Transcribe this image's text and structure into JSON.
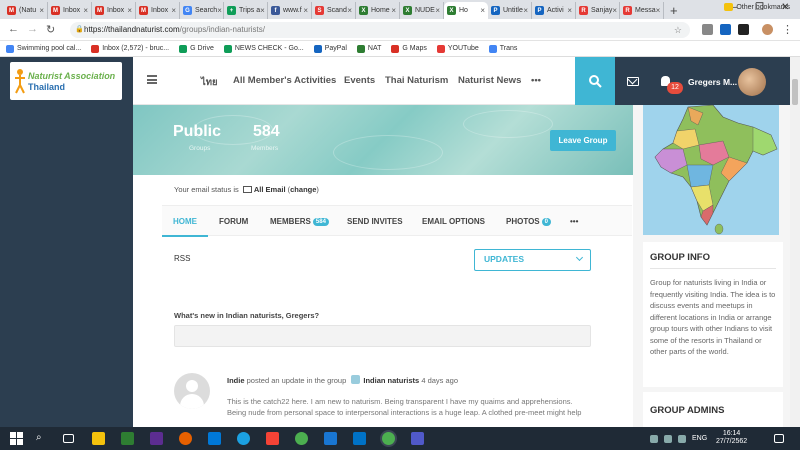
{
  "browser": {
    "tabs": [
      {
        "label": "(Natu",
        "color": "#d93025",
        "glyph": "M"
      },
      {
        "label": "Inbox",
        "color": "#d93025",
        "glyph": "M"
      },
      {
        "label": "Inbox",
        "color": "#d93025",
        "glyph": "M"
      },
      {
        "label": "Inbox",
        "color": "#d93025",
        "glyph": "M"
      },
      {
        "label": "Search",
        "color": "#4285f4",
        "glyph": "G"
      },
      {
        "label": "Trips a",
        "color": "#0f9d58",
        "glyph": "+"
      },
      {
        "label": "www.f",
        "color": "#3b5998",
        "glyph": "f"
      },
      {
        "label": "Scand",
        "color": "#e53935",
        "glyph": "S"
      },
      {
        "label": "Home",
        "color": "#2e7d32",
        "glyph": "X"
      },
      {
        "label": "NUDE",
        "color": "#2e7d32",
        "glyph": "X"
      },
      {
        "label": "Ho",
        "color": "#2e7d32",
        "glyph": "X",
        "active": true
      },
      {
        "label": "Untitle",
        "color": "#1565c0",
        "glyph": "P"
      },
      {
        "label": "Activi",
        "color": "#1565c0",
        "glyph": "P"
      },
      {
        "label": "Sanjay",
        "color": "#e53935",
        "glyph": "R"
      },
      {
        "label": "Messa",
        "color": "#e53935",
        "glyph": "R"
      }
    ],
    "url_domain": "https://thailandnaturist.com",
    "url_path": "/groups/indian-naturists/",
    "bookmarks": [
      {
        "label": "Swimming pool cal...",
        "color": "#4285f4"
      },
      {
        "label": "Inbox (2,572) - bruc...",
        "color": "#d93025"
      },
      {
        "label": "G Drive",
        "color": "#0f9d58"
      },
      {
        "label": "NEWS CHECK - Go...",
        "color": "#0f9d58"
      },
      {
        "label": "PayPal",
        "color": "#1565c0"
      },
      {
        "label": "NAT",
        "color": "#2e7d32"
      },
      {
        "label": "G Maps",
        "color": "#d93025"
      },
      {
        "label": "YOUTube",
        "color": "#e53935"
      },
      {
        "label": "Trans",
        "color": "#4285f4"
      }
    ],
    "other_bookmarks": "Other bookmarks"
  },
  "site": {
    "logo_line1": "Naturist Association",
    "logo_line2": "Thailand",
    "nav": [
      "ไทย",
      "All Member's Activities",
      "Events",
      "Thai Naturism",
      "Naturist News",
      "•••"
    ],
    "notif_count": "12",
    "username": "Gregers M..."
  },
  "group": {
    "privacy": "Public",
    "privacy_label": "Groups",
    "member_count": "584",
    "member_label": "Members",
    "leave_button": "Leave Group",
    "email_status_prefix": "Your email status is",
    "email_status_value": "All Email",
    "email_change": "change",
    "tabs": {
      "home": "HOME",
      "forum": "FORUM",
      "members": "MEMBERS",
      "members_count": "584",
      "invites": "SEND INVITES",
      "email": "EMAIL OPTIONS",
      "photos": "PHOTOS",
      "photos_count": "0",
      "more": "•••"
    },
    "rss": "RSS",
    "filter_value": "UPDATES",
    "whats_new": "What's new in Indian naturists, Gregers?",
    "activity": {
      "author": "Indie",
      "action": "posted an update in the group",
      "group": "Indian naturists",
      "time": "4 days ago",
      "text": "This is the catch22 here. I am new to naturism. Being transparent I have my quaims and apprehensions. Being nude from personal space to interpersonal interactions is a huge leap. A clothed pre-meet might help"
    }
  },
  "sidebar": {
    "info_title": "GROUP INFO",
    "info_text": "Group for naturists living in India or frequently visiting India. The idea is to discuss events and meetups in different locations in India or arrange group tours with other Indians to visit some of the resorts in Thailand or other parts of the world.",
    "admins_title": "GROUP ADMINS"
  },
  "taskbar": {
    "lang": "ENG",
    "time": "16:14",
    "date": "27/7/2562"
  },
  "colors": {
    "accent": "#3fb6d4",
    "dark": "#2c3e50",
    "badge": "#e74c3c"
  }
}
